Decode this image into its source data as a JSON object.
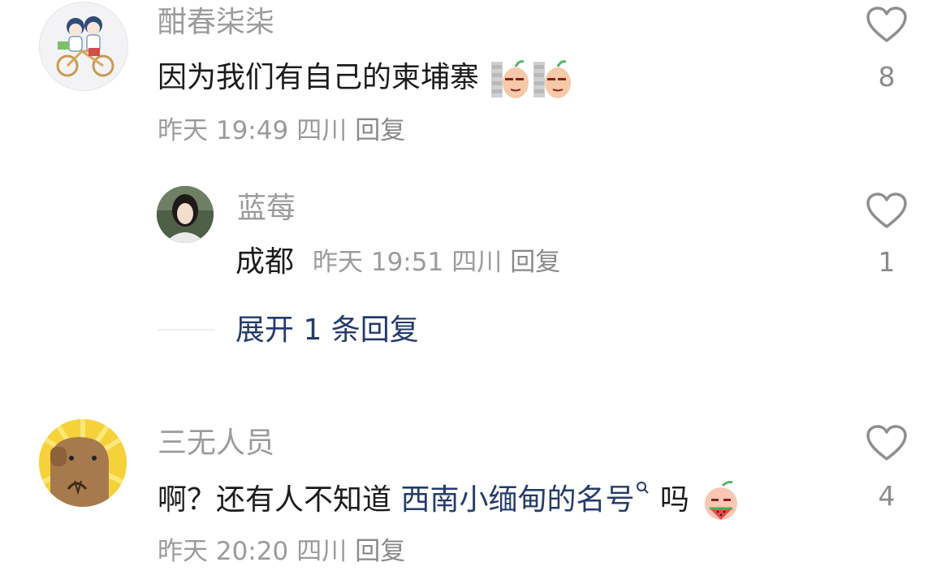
{
  "comments": [
    {
      "username": "酣春柒柒",
      "content": "因为我们有自己的柬埔寨",
      "emoji_names": [
        "peach-peek-emoji",
        "peach-peek-emoji"
      ],
      "time": "昨天 19:49",
      "location": "四川",
      "reply_label": "回复",
      "likes": "8",
      "replies": [
        {
          "username": "蓝莓",
          "content": "成都",
          "time": "昨天 19:51",
          "location": "四川",
          "reply_label": "回复",
          "likes": "1"
        }
      ],
      "expand_label": "展开 1 条回复"
    },
    {
      "username": "三无人员",
      "content_prefix": "啊？还有人不知道 ",
      "content_link": "西南小缅甸的名号",
      "content_suffix": " 吗",
      "emoji_names": [
        "peach-watermelon-emoji"
      ],
      "time": "昨天 20:20",
      "location": "四川",
      "reply_label": "回复",
      "likes": "4"
    }
  ],
  "icons": {
    "like": "heart-outline-icon",
    "search": "search-icon"
  },
  "colors": {
    "username": "#9b9b9b",
    "content": "#1c1c1c",
    "link": "#243b6b",
    "meta": "#9b9b9b"
  }
}
